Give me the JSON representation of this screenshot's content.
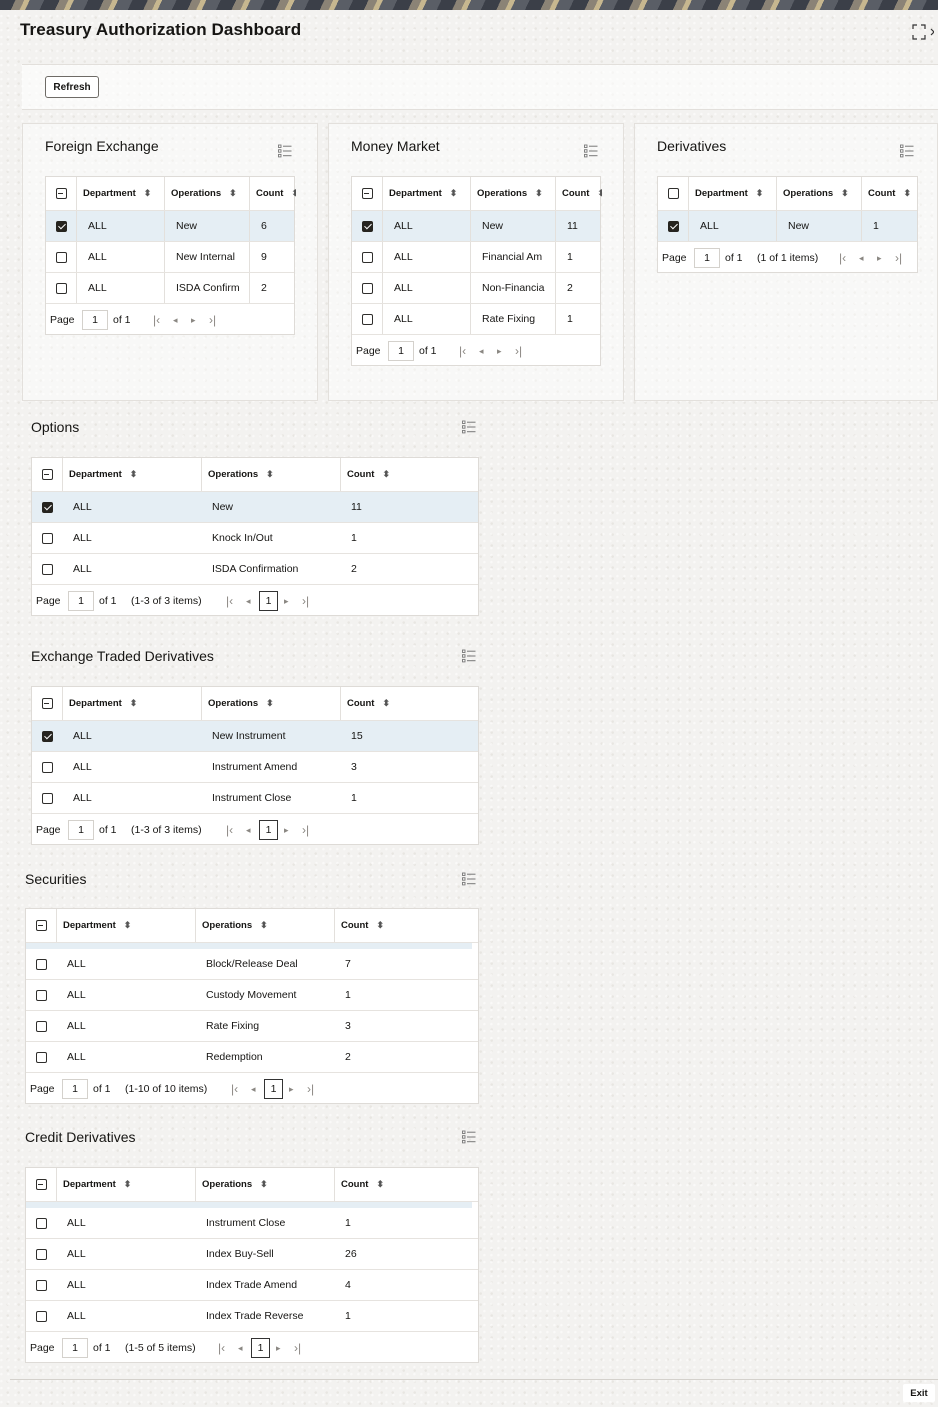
{
  "header": {
    "title": "Treasury Authorization Dashboard"
  },
  "toolbar": {
    "refresh_label": "Refresh"
  },
  "footer": {
    "exit_label": "Exit"
  },
  "pager_labels": {
    "page": "Page",
    "of": "of 1"
  },
  "panels": {
    "fx": {
      "title": "Foreign Exchange",
      "columns": [
        "Department",
        "Operations",
        "Count"
      ],
      "rows": [
        {
          "dept": "ALL",
          "op": "New",
          "count": "6"
        },
        {
          "dept": "ALL",
          "op": "New Internal",
          "count": "9"
        },
        {
          "dept": "ALL",
          "op": "ISDA Confirm",
          "count": "2"
        }
      ],
      "page": "1"
    },
    "mm": {
      "title": "Money Market",
      "columns": [
        "Department",
        "Operations",
        "Count"
      ],
      "rows": [
        {
          "dept": "ALL",
          "op": "New",
          "count": "11"
        },
        {
          "dept": "ALL",
          "op": "Financial Am",
          "count": "1"
        },
        {
          "dept": "ALL",
          "op": "Non-Financia",
          "count": "2"
        },
        {
          "dept": "ALL",
          "op": "Rate Fixing",
          "count": "1"
        }
      ],
      "page": "1"
    },
    "der": {
      "title": "Derivatives",
      "columns": [
        "Department",
        "Operations",
        "Count"
      ],
      "rows": [
        {
          "dept": "ALL",
          "op": "New",
          "count": "1"
        }
      ],
      "page": "1",
      "items_text": "(1 of 1 items)"
    },
    "opt": {
      "title": "Options",
      "columns": [
        "Department",
        "Operations",
        "Count"
      ],
      "rows": [
        {
          "dept": "ALL",
          "op": "New",
          "count": "11"
        },
        {
          "dept": "ALL",
          "op": "Knock In/Out",
          "count": "1"
        },
        {
          "dept": "ALL",
          "op": "ISDA Confirmation",
          "count": "2"
        }
      ],
      "page": "1",
      "items_text": "(1-3 of 3 items)",
      "current_page": "1"
    },
    "etd": {
      "title": "Exchange Traded Derivatives",
      "columns": [
        "Department",
        "Operations",
        "Count"
      ],
      "rows": [
        {
          "dept": "ALL",
          "op": "New Instrument",
          "count": "15"
        },
        {
          "dept": "ALL",
          "op": "Instrument Amend",
          "count": "3"
        },
        {
          "dept": "ALL",
          "op": "Instrument Close",
          "count": "1"
        }
      ],
      "page": "1",
      "items_text": "(1-3 of 3 items)",
      "current_page": "1"
    },
    "sec": {
      "title": "Securities",
      "columns": [
        "Department",
        "Operations",
        "Count"
      ],
      "rows": [
        {
          "dept": "ALL",
          "op": "Block/Release Deal",
          "count": "7"
        },
        {
          "dept": "ALL",
          "op": "Custody Movement",
          "count": "1"
        },
        {
          "dept": "ALL",
          "op": "Rate Fixing",
          "count": "3"
        },
        {
          "dept": "ALL",
          "op": "Redemption",
          "count": "2"
        }
      ],
      "page": "1",
      "items_text": "(1-10 of 10 items)",
      "current_page": "1"
    },
    "cd": {
      "title": "Credit Derivatives",
      "columns": [
        "Department",
        "Operations",
        "Count"
      ],
      "rows": [
        {
          "dept": "ALL",
          "op": "Instrument Close",
          "count": "1"
        },
        {
          "dept": "ALL",
          "op": "Index Buy-Sell",
          "count": "26"
        },
        {
          "dept": "ALL",
          "op": "Index Trade Amend",
          "count": "4"
        },
        {
          "dept": "ALL",
          "op": "Index Trade Reverse",
          "count": "1"
        }
      ],
      "page": "1",
      "items_text": "(1-5 of 5 items)",
      "current_page": "1"
    }
  }
}
